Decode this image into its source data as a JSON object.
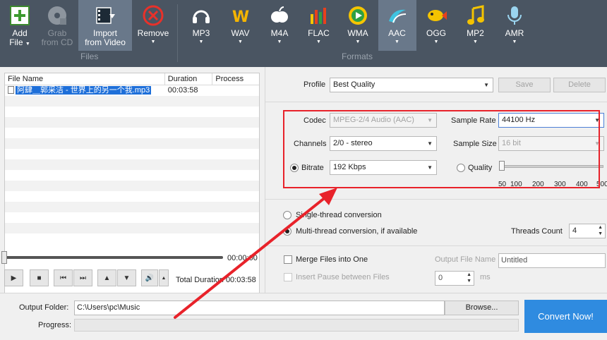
{
  "toolbar": {
    "add_file": {
      "label1": "Add",
      "label2": "File"
    },
    "grab_cd": {
      "label1": "Grab",
      "label2": "from CD"
    },
    "import_video": {
      "label1": "Import",
      "label2": "from Video"
    },
    "remove": {
      "label": "Remove"
    },
    "files_group": "Files",
    "formats_group": "Formats",
    "formats": [
      {
        "label": "MP3",
        "icon": "headphones-icon",
        "color": "#ffffff"
      },
      {
        "label": "WAV",
        "icon": "wav-w-icon",
        "color": "#f4b400"
      },
      {
        "label": "M4A",
        "icon": "apple-icon",
        "color": "#ffffff"
      },
      {
        "label": "FLAC",
        "icon": "equalizer-icon",
        "color": "#e8401c"
      },
      {
        "label": "WMA",
        "icon": "wma-play-icon",
        "color": "#2ea043"
      },
      {
        "label": "AAC",
        "icon": "aac-wave-icon",
        "color": "#3fc3e0"
      },
      {
        "label": "OGG",
        "icon": "fish-icon",
        "color": "#f4c300"
      },
      {
        "label": "MP2",
        "icon": "music-note-icon",
        "color": "#f4c300"
      },
      {
        "label": "AMR",
        "icon": "microphone-icon",
        "color": "#9ad4ef"
      }
    ]
  },
  "filelist": {
    "headers": [
      "File Name",
      "Duration",
      "Process"
    ],
    "rows": [
      {
        "name": "阿肆＿郭采洁 - 世界上的另一个我.mp3",
        "duration": "00:03:58",
        "process": ""
      }
    ]
  },
  "player": {
    "current_time": "00:00:00",
    "total_label": "Total Duration",
    "total_value": "00:03:58"
  },
  "settings": {
    "profile_label": "Profile",
    "profile_value": "Best Quality",
    "save_label": "Save",
    "delete_label": "Delete",
    "codec_label": "Codec",
    "codec_value": "MPEG-2/4 Audio (AAC)",
    "sample_rate_label": "Sample Rate",
    "sample_rate_value": "44100 Hz",
    "channels_label": "Channels",
    "channels_value": "2/0 - stereo",
    "sample_size_label": "Sample Size",
    "sample_size_value": "16 bit",
    "bitrate_label": "Bitrate",
    "bitrate_value": "192 Kbps",
    "quality_label": "Quality",
    "quality_ticks": [
      "50",
      "100",
      "200",
      "300",
      "400",
      "500"
    ],
    "single_thread_label": "Single-thread conversion",
    "multi_thread_label": "Multi-thread conversion, if available",
    "threads_label": "Threads Count",
    "threads_value": "4",
    "merge_label": "Merge Files into One",
    "output_name_label": "Output File Name",
    "output_name_placeholder": "Untitled",
    "pause_label": "Insert Pause between Files",
    "pause_value": "0",
    "pause_unit": "ms"
  },
  "bottom": {
    "output_folder_label": "Output Folder:",
    "output_folder_value": "C:\\Users\\pc\\Music",
    "browse_label": "Browse...",
    "progress_label": "Progress:",
    "convert_label": "Convert Now!"
  }
}
